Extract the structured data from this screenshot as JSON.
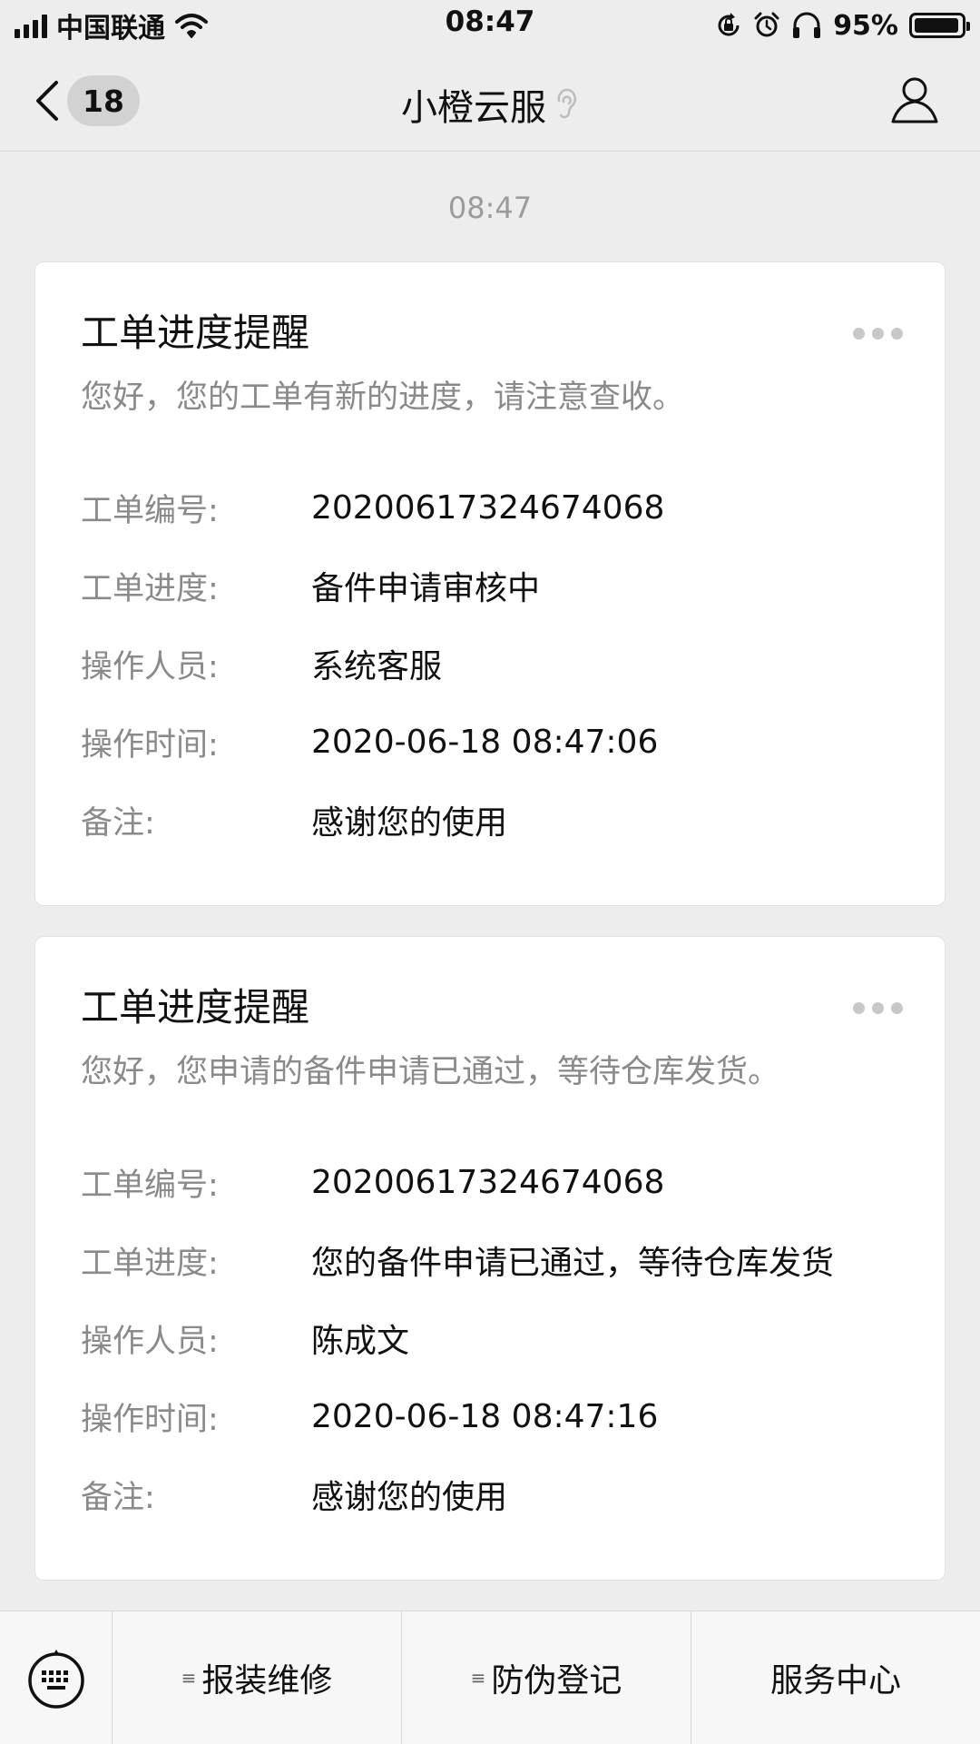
{
  "status_bar": {
    "carrier": "中国联通",
    "time": "08:47",
    "battery_percent": "95%",
    "battery_level": 0.95,
    "icons": [
      "signal-icon",
      "wifi-icon",
      "rotation-lock-icon",
      "alarm-icon",
      "headphones-icon",
      "battery-icon"
    ]
  },
  "nav": {
    "unread_count": "18",
    "title": "小橙云服",
    "icons": [
      "back-chevron-icon",
      "ear-icon",
      "profile-icon"
    ]
  },
  "chat": {
    "timestamp": "08:47",
    "cards": [
      {
        "title": "工单进度提醒",
        "description": "您好，您的工单有新的进度，请注意查收。",
        "fields": [
          {
            "label": "工单编号:",
            "value": "20200617324674068"
          },
          {
            "label": "工单进度:",
            "value": "备件申请审核中"
          },
          {
            "label": "操作人员:",
            "value": "系统客服"
          },
          {
            "label": "操作时间:",
            "value": "2020-06-18 08:47:06"
          },
          {
            "label": "备注:",
            "value": "感谢您的使用"
          }
        ]
      },
      {
        "title": "工单进度提醒",
        "description": "您好，您申请的备件申请已通过，等待仓库发货。",
        "fields": [
          {
            "label": "工单编号:",
            "value": "20200617324674068"
          },
          {
            "label": "工单进度:",
            "value": "您的备件申请已通过，等待仓库发货"
          },
          {
            "label": "操作人员:",
            "value": "陈成文"
          },
          {
            "label": "操作时间:",
            "value": "2020-06-18 08:47:16"
          },
          {
            "label": "备注:",
            "value": "感谢您的使用"
          }
        ]
      }
    ]
  },
  "bottom_menu": {
    "items": [
      {
        "label": "报装维修",
        "has_submenu": true
      },
      {
        "label": "防伪登记",
        "has_submenu": true
      },
      {
        "label": "服务中心",
        "has_submenu": false
      }
    ],
    "icons": [
      "keyboard-icon",
      "submenu-icon"
    ]
  },
  "colors": {
    "background": "#ededed",
    "card": "#ffffff",
    "label_gray": "#8a8a8a",
    "text": "#111111",
    "badge": "#d2d2d2"
  }
}
